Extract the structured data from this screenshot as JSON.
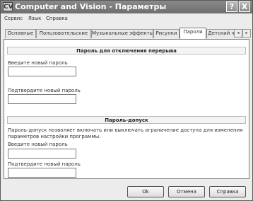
{
  "window": {
    "icon_text": "CV",
    "title": "Computer and Vision - Параметры",
    "help_label": "?",
    "close_label": "X"
  },
  "menu": [
    "Сервис",
    "Язык",
    "Справка"
  ],
  "tabs": [
    {
      "label": "Основные",
      "active": false
    },
    {
      "label": "Пользовательские",
      "active": false
    },
    {
      "label": "Музыкальные эффекты",
      "active": false
    },
    {
      "label": "Рисунки",
      "active": false
    },
    {
      "label": "Пароли",
      "active": true
    },
    {
      "label": "Детский час",
      "active": false
    }
  ],
  "tab_scroll": {
    "left": "◂",
    "right": "▸"
  },
  "break_password": {
    "title": "Пароль для отключения перерыва",
    "new_label": "Введите новый пароль",
    "new_value": "",
    "confirm_label": "Подтвердите новый пароль",
    "confirm_value": ""
  },
  "access_password": {
    "title": "Пароль-допуск",
    "description": "Пароль-допуск позволяет включать или выключать ограничение доступа для изменения параметров настройки программы.",
    "new_label": "Введите новый пароль",
    "new_value": "",
    "confirm_label": "Подтвердите новый пароль",
    "confirm_value": ""
  },
  "buttons": {
    "ok": "Ok",
    "cancel": "Отмена",
    "help": "Справка"
  }
}
